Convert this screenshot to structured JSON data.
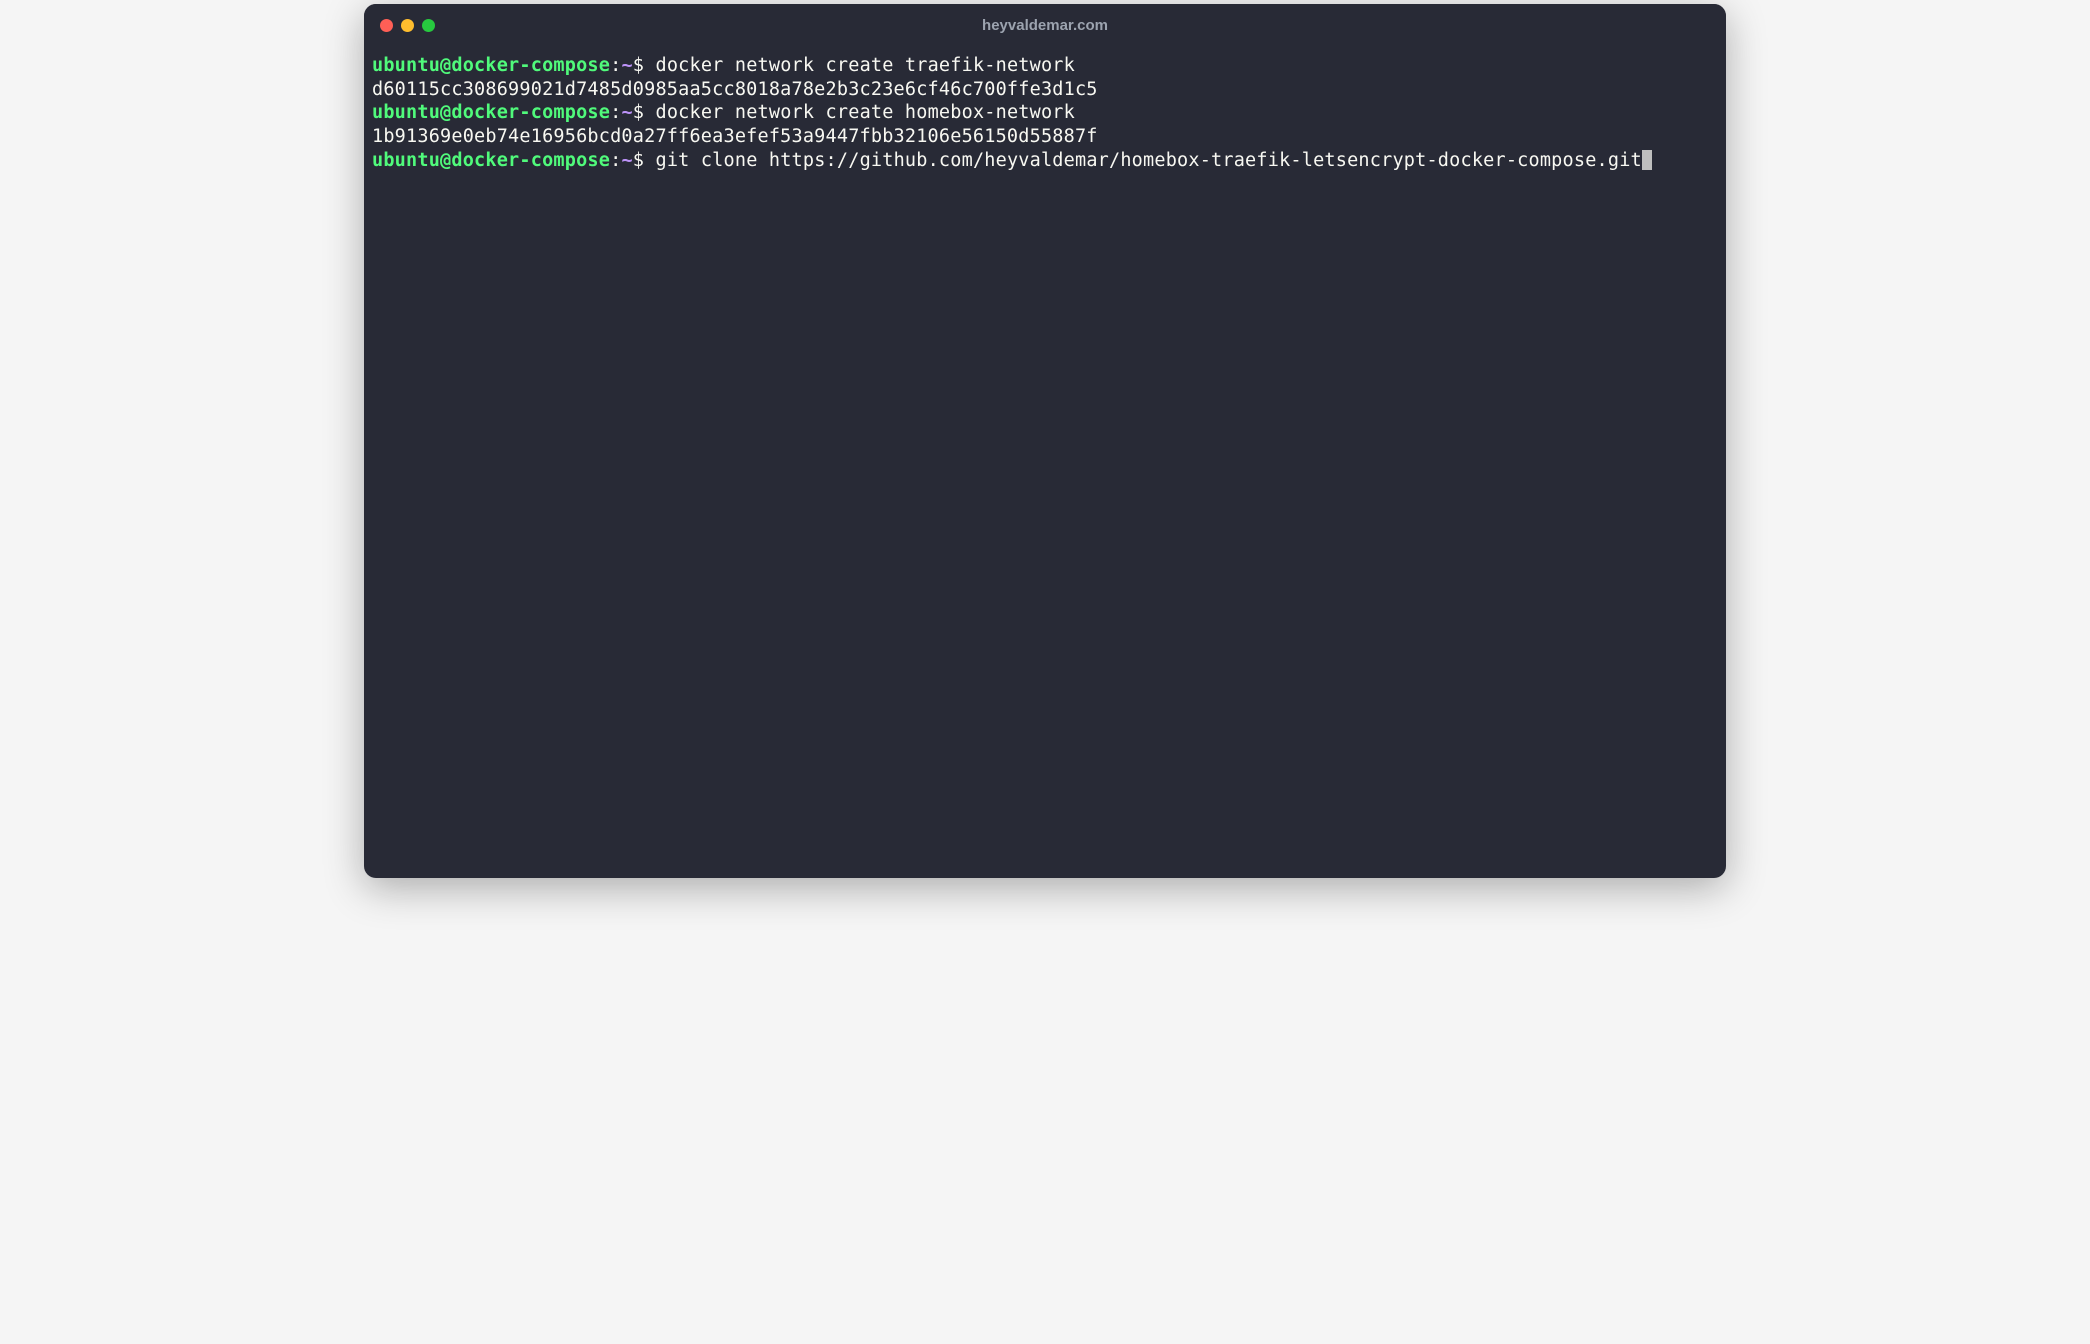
{
  "window": {
    "title": "heyvaldemar.com"
  },
  "prompt": {
    "user_host": "ubuntu@docker-compose",
    "separator": ":",
    "path": "~",
    "symbol": "$"
  },
  "lines": {
    "0": {
      "command": "docker network create traefik-network"
    },
    "1": {
      "output": "d60115cc308699021d7485d0985aa5cc8018a78e2b3c23e6cf46c700ffe3d1c5"
    },
    "2": {
      "command": "docker network create homebox-network"
    },
    "3": {
      "output": "1b91369e0eb74e16956bcd0a27ff6ea3efef53a9447fbb32106e56150d55887f"
    },
    "4": {
      "command": "git clone https://github.com/heyvaldemar/homebox-traefik-letsencrypt-docker-compose.git"
    }
  }
}
